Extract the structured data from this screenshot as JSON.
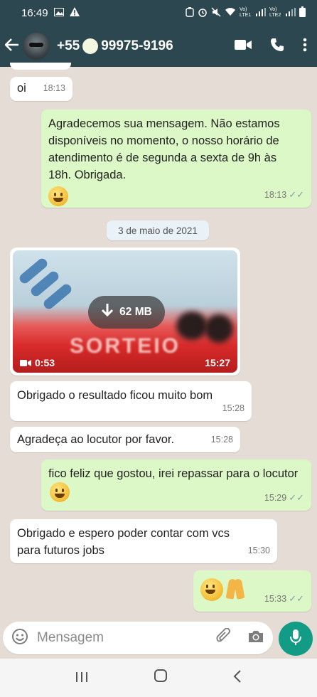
{
  "status_bar": {
    "time": "16:49",
    "sim1_label": "Vo) LTE1",
    "sim2_label": "Vo) LTE2"
  },
  "header": {
    "contact_prefix": "+55",
    "contact_suffix": "99975-9196"
  },
  "messages": [
    {
      "dir": "in",
      "text": "oi",
      "time": "18:13"
    },
    {
      "dir": "out",
      "text": "Agradecemos sua mensagem. Não estamos disponíveis no momento, o nosso horário de atendimento é de segunda a sexta de 9h às 18h. Obrigada.",
      "emoji": "grinning-face",
      "time": "18:13"
    },
    {
      "dir": "in",
      "text": "Obrigado o resultado ficou muito bom",
      "time": "15:28"
    },
    {
      "dir": "in",
      "text": "Agradeça ao locutor por favor.",
      "time": "15:28"
    },
    {
      "dir": "out",
      "text": "fico feliz que gostou, irei repassar para o locutor",
      "emoji": "smiling-face",
      "time": "15:29"
    },
    {
      "dir": "in",
      "text": "Obrigado e espero poder contar com vcs para futuros jobs",
      "time": "15:30"
    },
    {
      "dir": "out",
      "text": "",
      "emoji": "smiling-face+folded-hands",
      "time": "15:33"
    }
  ],
  "date_divider": "3 de maio de 2021",
  "video": {
    "size": "62 MB",
    "duration": "0:53",
    "time": "15:27",
    "overlay_text": "SORTEIO"
  },
  "composer": {
    "placeholder": "Mensagem"
  },
  "colors": {
    "header": "#2c474f",
    "outgoing": "#dcf8c6",
    "incoming": "#ffffff",
    "accent": "#129c86"
  }
}
